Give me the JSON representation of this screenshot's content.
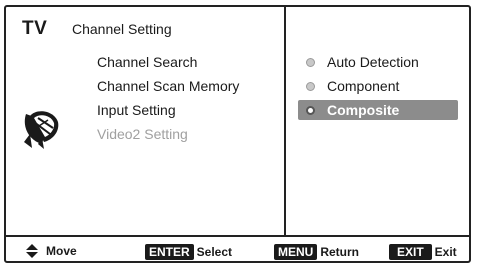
{
  "header": {
    "tv_label": "TV",
    "title": "Channel Setting"
  },
  "menu": {
    "items": [
      {
        "label": "Channel Search",
        "enabled": true
      },
      {
        "label": "Channel Scan Memory",
        "enabled": true
      },
      {
        "label": "Input Setting",
        "enabled": true
      },
      {
        "label": "Video2 Setting",
        "enabled": false
      }
    ],
    "icon": "antenna-dish-icon"
  },
  "options": {
    "items": [
      {
        "label": "Auto Detection",
        "selected": false
      },
      {
        "label": "Component",
        "selected": false
      },
      {
        "label": "Composite",
        "selected": true
      }
    ]
  },
  "footer": {
    "move_icon": "up-down-arrows-icon",
    "move_label": "Move",
    "enter_key": "ENTER",
    "enter_label": "Select",
    "menu_key": "MENU",
    "menu_label": "Return",
    "exit_key": "EXIT",
    "exit_label": "Exit"
  }
}
